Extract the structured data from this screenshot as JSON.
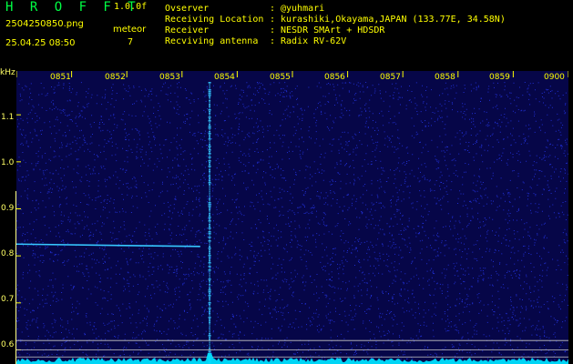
{
  "header": {
    "app_title": "H R O F F T",
    "app_version": "1.0.0f",
    "file_name": "2504250850.png",
    "timestamp": "25.04.25 08:50",
    "meteor_label": "meteor",
    "meteor_count": "7",
    "info": [
      {
        "label": "Ovserver",
        "value": "@yuhmari"
      },
      {
        "label": "Receiving Location",
        "value": "kurashiki,Okayama,JAPAN (133.77E, 34.58N)"
      },
      {
        "label": "Receiver",
        "value": "NESDR SMArt + HDSDR"
      },
      {
        "label": "Recviving antenna",
        "value": "Radix RV-62V"
      }
    ]
  },
  "spectrogram": {
    "y_unit": "kHz",
    "y_ticks": [
      "1.1",
      "1.0",
      "0.9",
      "0.8",
      "0.7",
      "0.6"
    ],
    "x_ticks": [
      "0851",
      "0852",
      "0853",
      "0854",
      "0855",
      "0856",
      "0857",
      "0858",
      "0859",
      "0900"
    ],
    "colors": {
      "background": "#060648",
      "noise": "#2a3cff",
      "meteor": "#36c8ff",
      "trace": "#00e0ff",
      "axis": "#ffff00",
      "ref_line": "#c8c8c8"
    },
    "y_range": [
      0.57,
      1.17
    ],
    "x_range_minutes": [
      0,
      10
    ],
    "events": {
      "carrier_line": {
        "start_min": 0,
        "end_min": 3.33,
        "freq_start_khz": 0.825,
        "freq_end_khz": 0.82
      },
      "meteor_burst": {
        "time_min": 3.5
      },
      "ref_lines_khz": [
        0.62,
        0.6,
        0.585
      ]
    }
  }
}
